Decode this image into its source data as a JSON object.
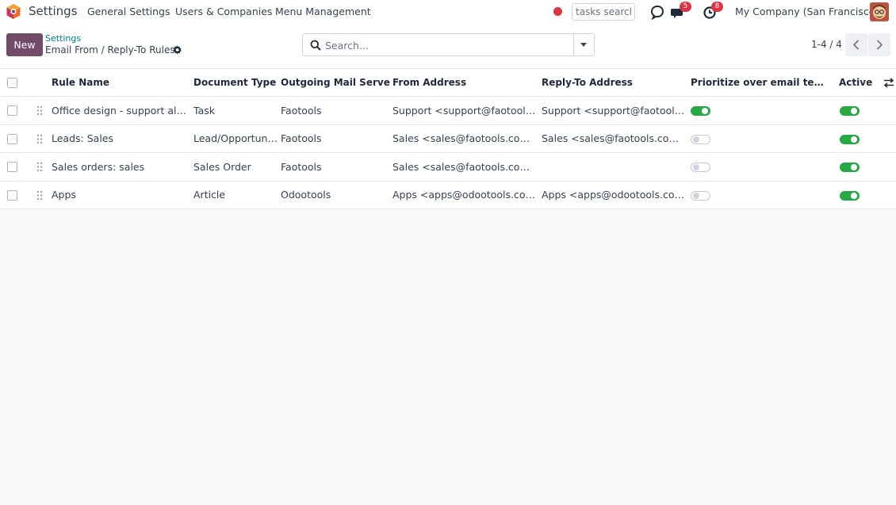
{
  "navbar": {
    "app_title": "Settings",
    "menus": [
      "General Settings",
      "Users & Companies",
      "Menu Management"
    ],
    "tasks_search_value": "tasks search",
    "messages_count": "5",
    "activities_count": "8",
    "company": "My Company (San Francisco)"
  },
  "control": {
    "new_label": "New",
    "breadcrumb_parent": "Settings",
    "breadcrumb_current": "Email From / Reply-To Rules",
    "search_placeholder": "Search...",
    "pager": "1-4 / 4"
  },
  "list": {
    "columns": [
      "Rule Name",
      "Document Type",
      "Outgoing Mail Server",
      "From Address",
      "Reply-To Address",
      "Prioritize over email templ...",
      "Active"
    ],
    "rows": [
      {
        "name": "Office design - support always",
        "doc_type": "Task",
        "server": "Faotools",
        "from": "Support <support@faotools.c...",
        "reply_to": "Support <support@faotools.c...",
        "prioritize": true,
        "active": true
      },
      {
        "name": "Leads: Sales",
        "doc_type": "Lead/Opportunity",
        "server": "Faotools",
        "from": "Sales <sales@faotools.com>",
        "reply_to": "Sales <sales@faotools.com>",
        "prioritize": false,
        "active": true
      },
      {
        "name": "Sales orders: sales",
        "doc_type": "Sales Order",
        "server": "Faotools",
        "from": "Sales <sales@faotools.com>",
        "reply_to": "",
        "prioritize": false,
        "active": true
      },
      {
        "name": "Apps",
        "doc_type": "Article",
        "server": "Odootools",
        "from": "Apps <apps@odootools.com>",
        "reply_to": "Apps <apps@odootools.com>",
        "prioritize": false,
        "active": true
      }
    ]
  },
  "colors": {
    "brand": "#714b67",
    "toggle_on": "#28a745",
    "badge": "#dc3545",
    "link": "#017e84"
  }
}
